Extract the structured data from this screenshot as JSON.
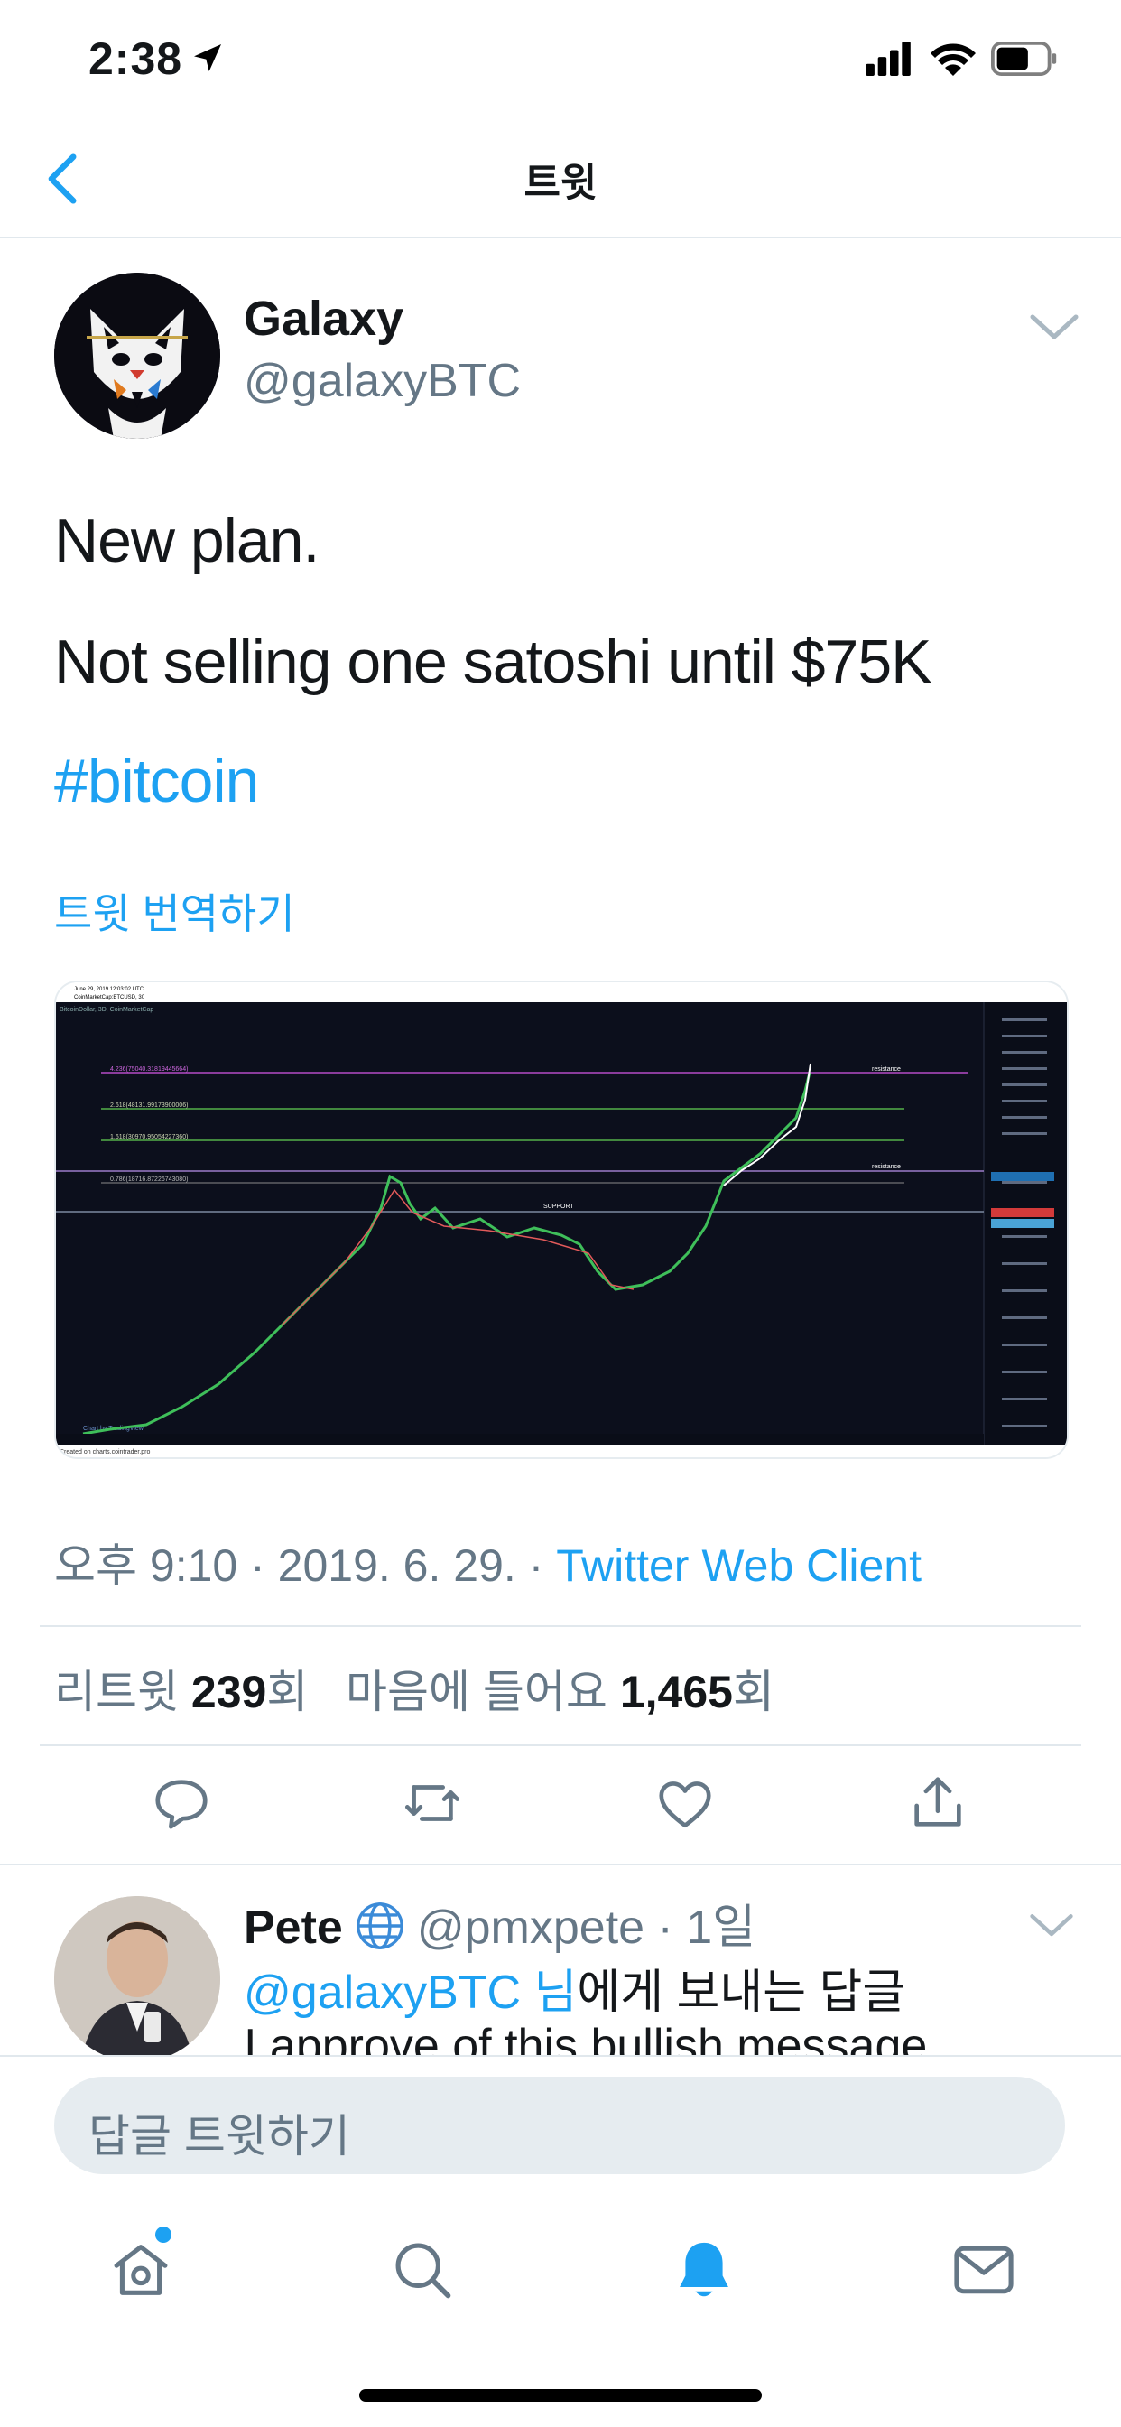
{
  "status_bar": {
    "time": "2:38"
  },
  "nav": {
    "title": "트윗"
  },
  "tweet": {
    "display_name": "Galaxy",
    "handle": "@galaxyBTC",
    "lines": [
      "New plan.",
      "Not selling one satoshi until $75K"
    ],
    "hashtag": "#bitcoin",
    "translate_label": "트윗 번역하기",
    "meta": {
      "time": "오후 9:10",
      "date": "2019. 6. 29.",
      "client": "Twitter Web Client"
    },
    "stats": {
      "retweets_label": "리트윗",
      "retweets_count": "239",
      "retweets_suffix": "회",
      "likes_label": "마음에 들어요",
      "likes_count": "1,465",
      "likes_suffix": "회"
    }
  },
  "media_chart": {
    "top_text": "June 29, 2019 12:03:02 UTC",
    "symbol": "CoinMarketCap:BTCUSD, 30",
    "header_label": "BitcoinDollar, 3D, CoinMarketCap",
    "fib_levels": [
      "4.236(75040.31819445664)",
      "2.618(48131.99173900006)",
      "1.618(30970.95054227360)",
      "0.786(18716.87226743080)"
    ],
    "resistance_label": "resistance",
    "support_label": "SUPPORT",
    "watermark": "Chart by TradingView",
    "footer": "Created on charts.cointrader.pro"
  },
  "reply": {
    "name": "Pete",
    "handle": "@pmxpete",
    "age": "1일",
    "reply_to_handle": "@galaxyBTC 님",
    "reply_to_rest": "에게 보내는 답글",
    "body": "I approve of this bullish message"
  },
  "composer": {
    "placeholder": "답글 트윗하기"
  },
  "colors": {
    "accent": "#1da1f2",
    "secondary_text": "#657786",
    "divider": "#e1e8ed"
  }
}
